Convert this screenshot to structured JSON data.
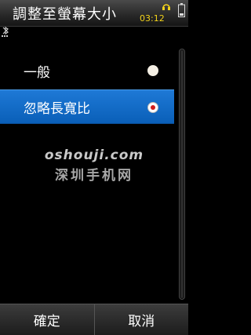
{
  "title": "調整至螢幕大小",
  "status": {
    "time": "03:12"
  },
  "options": [
    {
      "label": "一般",
      "checked": false
    },
    {
      "label": "忽略長寬比",
      "checked": true
    }
  ],
  "watermark": {
    "url": "oshouji.com",
    "site": "深圳手机网"
  },
  "softkeys": {
    "left": "確定",
    "right": "取消"
  },
  "colors": {
    "selection": "#0f66c2",
    "clock": "#f2d21a"
  }
}
